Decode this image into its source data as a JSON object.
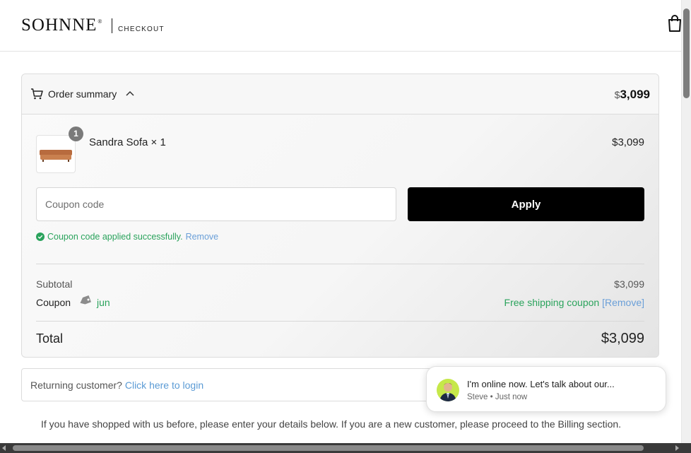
{
  "header": {
    "logo": "SOHNNE",
    "logo_mark": "®",
    "subtitle": "CHECKOUT",
    "bag_icon": "shopping-bag-icon"
  },
  "summary": {
    "title": "Order summary",
    "total_currency": "$",
    "total_amount": "3,099",
    "item": {
      "quantity_badge": "1",
      "name": "Sandra Sofa × 1",
      "price": "$3,099",
      "thumbnail_icon": "sofa-thumbnail"
    },
    "coupon": {
      "placeholder": "Coupon code",
      "apply_label": "Apply",
      "success_message": "Coupon code applied successfully.",
      "remove_label": "Remove"
    },
    "subtotal_label": "Subtotal",
    "subtotal_value": "$3,099",
    "coupon_label": "Coupon",
    "coupon_code": "jun",
    "shipping_coupon": "Free shipping coupon",
    "shipping_remove": "[Remove]",
    "total_label": "Total",
    "total_value": "$3,099"
  },
  "returning": {
    "prompt": "Returning customer?",
    "link": "Click here to login"
  },
  "info_text": "If you have shopped with us before, please enter your details below. If you are a new customer, please proceed to the Billing section.",
  "chat": {
    "message": "I'm online now. Let's talk about our...",
    "meta": "Steve • Just now"
  },
  "colors": {
    "success": "#2aa35c",
    "link": "#5b9bd5",
    "button": "#000000"
  }
}
